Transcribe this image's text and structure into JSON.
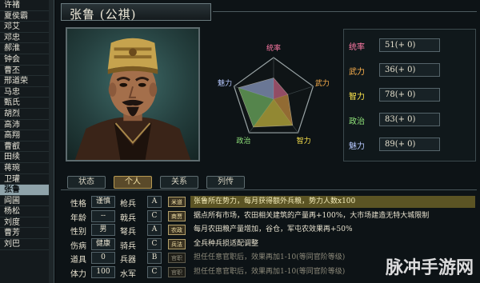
{
  "roster": {
    "items": [
      "许褚",
      "夏侯霸",
      "邓艾",
      "邓忠",
      "郝淮",
      "钟会",
      "曹丕",
      "邢道荣",
      "马忠",
      "甄氏",
      "胡烈",
      "高沛",
      "高翔",
      "曹叡",
      "田续",
      "蒋琬",
      "卫瓘",
      "张鲁",
      "阎圃",
      "杨松",
      "刘度",
      "曹芳",
      "刘巴"
    ],
    "selected_index": 17
  },
  "header": {
    "name": "张鲁 (公祺)"
  },
  "radar": {
    "labels": [
      "统率",
      "武力",
      "智力",
      "政治",
      "魅力"
    ],
    "values": [
      51,
      36,
      78,
      83,
      89
    ],
    "max": 100,
    "label_colors": [
      "#ff7aa6",
      "#ffb24d",
      "#ffe74d",
      "#8fe27a",
      "#b6c8ff"
    ]
  },
  "stats": [
    {
      "label": "统率",
      "value": "51(+ 0)",
      "color": "#ff7aa6"
    },
    {
      "label": "武力",
      "value": "36(+ 0)",
      "color": "#ffb24d"
    },
    {
      "label": "智力",
      "value": "78(+ 0)",
      "color": "#ffe74d"
    },
    {
      "label": "政治",
      "value": "83(+ 0)",
      "color": "#8fe27a"
    },
    {
      "label": "魅力",
      "value": "89(+ 0)",
      "color": "#b6c8ff"
    }
  ],
  "tabs": [
    {
      "label": "状态",
      "active": false
    },
    {
      "label": "个人",
      "active": true
    },
    {
      "label": "关系",
      "active": false
    },
    {
      "label": "列传",
      "active": false
    }
  ],
  "attributes": [
    {
      "label": "性格",
      "value": "谨慎",
      "label2": "枪兵",
      "grade": "A"
    },
    {
      "label": "年龄",
      "value": "--",
      "label2": "戟兵",
      "grade": "C"
    },
    {
      "label": "性别",
      "value": "男",
      "label2": "弩兵",
      "grade": "A"
    },
    {
      "label": "伤病",
      "value": "健康",
      "label2": "骑兵",
      "grade": "C"
    },
    {
      "label": "道具",
      "value": "0",
      "label2": "兵器",
      "grade": "B"
    },
    {
      "label": "体力",
      "value": "100",
      "label2": "水军",
      "grade": "C"
    }
  ],
  "traits": [
    {
      "tag": "米道",
      "text": "张鲁所在势力，每月获得额外兵粮，势力人数x100",
      "style": "hl"
    },
    {
      "tag": "商贾",
      "text": "据点所有市场，农田相关建筑的产量再+100%，大市场建造无特大城限制",
      "style": ""
    },
    {
      "tag": "农政",
      "text": "每月农田粮产量增加，谷仓，军屯农效果再+50%",
      "style": ""
    },
    {
      "tag": "兵法",
      "text": "全兵种兵损适配调整",
      "style": ""
    },
    {
      "tag": "官职",
      "text": "担任任意官职后，效果再加1-10(等同官阶等级)",
      "style": "dim"
    },
    {
      "tag": "官职",
      "text": "担任任意官职后，效果再加1-10(等同官阶等级)",
      "style": "dim"
    }
  ],
  "watermark": {
    "text": "脉冲手游网"
  },
  "colors": {
    "accent_gold": "#b79a52",
    "panel_border": "#5d6b6e"
  }
}
